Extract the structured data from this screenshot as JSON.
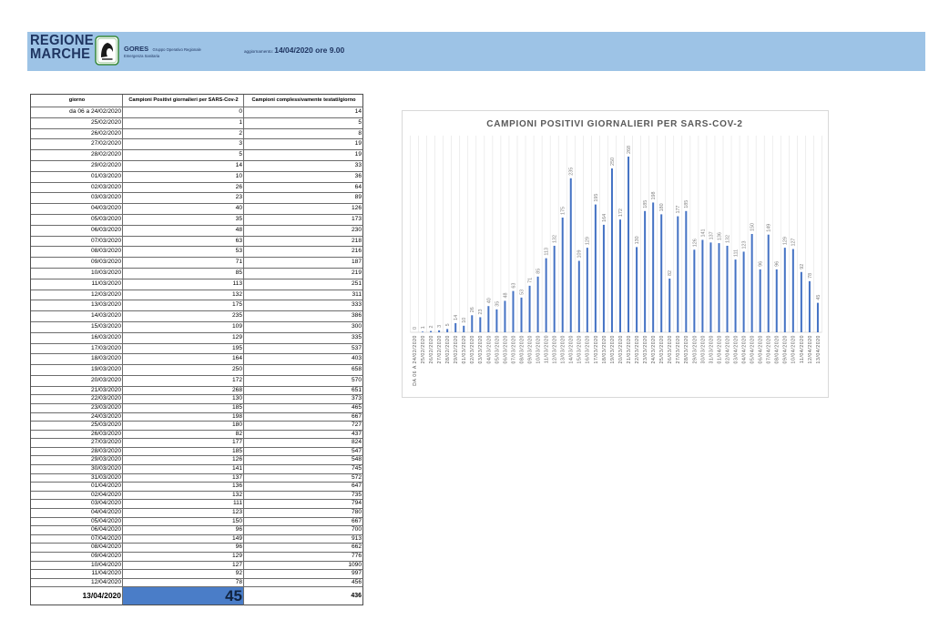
{
  "header": {
    "logo_line1": "REGIONE",
    "logo_line2": "MARCHE",
    "org_acronym": "GORES",
    "org_name_line1": "Gruppo Operativo Regionale",
    "org_name_line2": "Emergenza Sanitaria",
    "update_label": "aggiornamento:",
    "update_value": "14/04/2020 ore 9.00",
    "bar_color": "#9DC3E6"
  },
  "table": {
    "columns": [
      "giorno",
      "Campioni Positivi giornalieri per SARS-Cov-2",
      "Campioni complessivamente testati/giorno"
    ],
    "rows": [
      {
        "giorno": "da 06 a 24/02/2020",
        "positivi": 0,
        "testati": 14
      },
      {
        "giorno": "25/02/2020",
        "positivi": 1,
        "testati": 5
      },
      {
        "giorno": "26/02/2020",
        "positivi": 2,
        "testati": 8
      },
      {
        "giorno": "27/02/2020",
        "positivi": 3,
        "testati": 19
      },
      {
        "giorno": "28/02/2020",
        "positivi": 5,
        "testati": 19
      },
      {
        "giorno": "29/02/2020",
        "positivi": 14,
        "testati": 33
      },
      {
        "giorno": "01/03/2020",
        "positivi": 10,
        "testati": 36
      },
      {
        "giorno": "02/03/2020",
        "positivi": 26,
        "testati": 64
      },
      {
        "giorno": "03/03/2020",
        "positivi": 23,
        "testati": 89
      },
      {
        "giorno": "04/03/2020",
        "positivi": 40,
        "testati": 126
      },
      {
        "giorno": "05/03/2020",
        "positivi": 35,
        "testati": 173
      },
      {
        "giorno": "06/03/2020",
        "positivi": 48,
        "testati": 230
      },
      {
        "giorno": "07/03/2020",
        "positivi": 63,
        "testati": 218
      },
      {
        "giorno": "08/03/2020",
        "positivi": 53,
        "testati": 216
      },
      {
        "giorno": "09/03/2020",
        "positivi": 71,
        "testati": 187
      },
      {
        "giorno": "10/03/2020",
        "positivi": 85,
        "testati": 219
      },
      {
        "giorno": "11/03/2020",
        "positivi": 113,
        "testati": 251
      },
      {
        "giorno": "12/03/2020",
        "positivi": 132,
        "testati": 311
      },
      {
        "giorno": "13/03/2020",
        "positivi": 175,
        "testati": 333
      },
      {
        "giorno": "14/03/2020",
        "positivi": 235,
        "testati": 386
      },
      {
        "giorno": "15/03/2020",
        "positivi": 109,
        "testati": 300
      },
      {
        "giorno": "16/03/2020",
        "positivi": 129,
        "testati": 335
      },
      {
        "giorno": "17/03/2020",
        "positivi": 195,
        "testati": 537
      },
      {
        "giorno": "18/03/2020",
        "positivi": 164,
        "testati": 403
      },
      {
        "giorno": "19/03/2020",
        "positivi": 250,
        "testati": 658
      },
      {
        "giorno": "20/03/2020",
        "positivi": 172,
        "testati": 570
      },
      {
        "giorno": "21/03/2020",
        "positivi": 268,
        "testati": 651
      },
      {
        "giorno": "22/03/2020",
        "positivi": 130,
        "testati": 373
      },
      {
        "giorno": "23/03/2020",
        "positivi": 185,
        "testati": 465
      },
      {
        "giorno": "24/03/2020",
        "positivi": 198,
        "testati": 667
      },
      {
        "giorno": "25/03/2020",
        "positivi": 180,
        "testati": 727
      },
      {
        "giorno": "26/03/2020",
        "positivi": 82,
        "testati": 437
      },
      {
        "giorno": "27/03/2020",
        "positivi": 177,
        "testati": 824
      },
      {
        "giorno": "28/03/2020",
        "positivi": 185,
        "testati": 547
      },
      {
        "giorno": "29/03/2020",
        "positivi": 126,
        "testati": 548
      },
      {
        "giorno": "30/03/2020",
        "positivi": 141,
        "testati": 745
      },
      {
        "giorno": "31/03/2020",
        "positivi": 137,
        "testati": 572
      },
      {
        "giorno": "01/04/2020",
        "positivi": 136,
        "testati": 647
      },
      {
        "giorno": "02/04/2020",
        "positivi": 132,
        "testati": 735
      },
      {
        "giorno": "03/04/2020",
        "positivi": 111,
        "testati": 794
      },
      {
        "giorno": "04/04/2020",
        "positivi": 123,
        "testati": 780
      },
      {
        "giorno": "05/04/2020",
        "positivi": 150,
        "testati": 667
      },
      {
        "giorno": "06/04/2020",
        "positivi": 96,
        "testati": 700
      },
      {
        "giorno": "07/04/2020",
        "positivi": 149,
        "testati": 913
      },
      {
        "giorno": "08/04/2020",
        "positivi": 96,
        "testati": 662
      },
      {
        "giorno": "09/04/2020",
        "positivi": 129,
        "testati": 776
      },
      {
        "giorno": "10/04/2020",
        "positivi": 127,
        "testati": 1090
      },
      {
        "giorno": "11/04/2020",
        "positivi": 92,
        "testati": 997
      },
      {
        "giorno": "12/04/2020",
        "positivi": 78,
        "testati": 456
      }
    ],
    "last_row": {
      "giorno": "13/04/2020",
      "positivi": 45,
      "testati": 436
    },
    "highlight_color": "#4A7DC8"
  },
  "chart_data": {
    "type": "bar",
    "title": "CAMPIONI POSITIVI GIORNALIERI PER SARS-COV-2",
    "xlabel": "",
    "ylabel": "",
    "categories": [
      "DA 06 A 24/02/2020",
      "25/02/2020",
      "26/02/2020",
      "27/02/2020",
      "28/02/2020",
      "29/02/2020",
      "01/03/2020",
      "02/03/2020",
      "03/03/2020",
      "04/03/2020",
      "05/03/2020",
      "06/03/2020",
      "07/03/2020",
      "08/03/2020",
      "09/03/2020",
      "10/03/2020",
      "11/03/2020",
      "12/03/2020",
      "13/03/2020",
      "14/03/2020",
      "15/03/2020",
      "16/03/2020",
      "17/03/2020",
      "18/03/2020",
      "19/03/2020",
      "20/03/2020",
      "21/03/2020",
      "22/03/2020",
      "23/03/2020",
      "24/03/2020",
      "25/03/2020",
      "26/03/2020",
      "27/03/2020",
      "28/03/2020",
      "29/03/2020",
      "30/03/2020",
      "31/03/2020",
      "01/04/2020",
      "02/04/2020",
      "03/04/2020",
      "04/04/2020",
      "05/04/2020",
      "06/04/2020",
      "07/04/2020",
      "08/04/2020",
      "09/04/2020",
      "10/04/2020",
      "11/04/2020",
      "12/04/2020",
      "13/04/2020"
    ],
    "values": [
      0,
      1,
      2,
      3,
      5,
      14,
      10,
      26,
      23,
      40,
      35,
      48,
      63,
      53,
      71,
      85,
      113,
      132,
      175,
      235,
      109,
      129,
      195,
      164,
      250,
      172,
      268,
      130,
      185,
      198,
      180,
      82,
      177,
      185,
      126,
      141,
      137,
      136,
      132,
      111,
      123,
      150,
      96,
      149,
      96,
      129,
      127,
      92,
      78,
      45
    ],
    "ylim": [
      0,
      300
    ],
    "grid": true,
    "data_labels": true,
    "bar_color": "#4472C4"
  }
}
